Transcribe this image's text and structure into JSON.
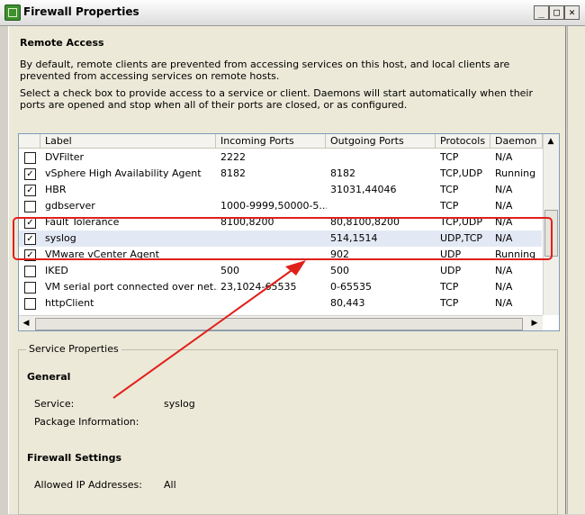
{
  "window": {
    "title": "Firewall Properties",
    "minimize": "_",
    "maximize": "□",
    "close": "✕"
  },
  "remote_access": {
    "heading": "Remote Access",
    "para1": "By default, remote clients are prevented from accessing services on this host, and local clients are prevented from accessing services on remote hosts.",
    "para2": "Select a check box to provide access to a service or client. Daemons will start automatically when their ports are opened and stop when all of their ports are closed, or as configured."
  },
  "table": {
    "columns": [
      "Label",
      "Incoming Ports",
      "Outgoing Ports",
      "Protocols",
      "Daemon"
    ],
    "rows": [
      {
        "checked": false,
        "label": "DVFilter",
        "incoming": "2222",
        "outgoing": "",
        "protocols": "TCP",
        "daemon": "N/A"
      },
      {
        "checked": true,
        "label": "vSphere High Availability Agent",
        "incoming": "8182",
        "outgoing": "8182",
        "protocols": "TCP,UDP",
        "daemon": "Running"
      },
      {
        "checked": true,
        "label": "HBR",
        "incoming": "",
        "outgoing": "31031,44046",
        "protocols": "TCP",
        "daemon": "N/A"
      },
      {
        "checked": false,
        "label": "gdbserver",
        "incoming": "1000-9999,50000-5...",
        "outgoing": "",
        "protocols": "TCP",
        "daemon": "N/A"
      },
      {
        "checked": true,
        "label": "Fault Tolerance",
        "incoming": "8100,8200",
        "outgoing": "80,8100,8200",
        "protocols": "TCP,UDP",
        "daemon": "N/A"
      },
      {
        "checked": true,
        "label": "syslog",
        "incoming": "",
        "outgoing": "514,1514",
        "protocols": "UDP,TCP",
        "daemon": "N/A",
        "selected": true
      },
      {
        "checked": true,
        "label": "VMware vCenter Agent",
        "incoming": "",
        "outgoing": "902",
        "protocols": "UDP",
        "daemon": "Running"
      },
      {
        "checked": false,
        "label": "IKED",
        "incoming": "500",
        "outgoing": "500",
        "protocols": "UDP",
        "daemon": "N/A"
      },
      {
        "checked": false,
        "label": "VM serial port connected over net...",
        "incoming": "23,1024-65535",
        "outgoing": "0-65535",
        "protocols": "TCP",
        "daemon": "N/A"
      },
      {
        "checked": false,
        "label": "httpClient",
        "incoming": "",
        "outgoing": "80,443",
        "protocols": "TCP",
        "daemon": "N/A"
      }
    ]
  },
  "service_properties": {
    "legend": "Service Properties",
    "general_heading": "General",
    "service_label": "Service:",
    "service_value": "syslog",
    "package_label": "Package Information:",
    "package_value": "",
    "firewall_heading": "Firewall Settings",
    "allowed_ip_label": "Allowed IP Addresses:",
    "allowed_ip_value": "All"
  },
  "colors": {
    "annotation": "#e0201a",
    "selection": "#e3e9f4"
  }
}
